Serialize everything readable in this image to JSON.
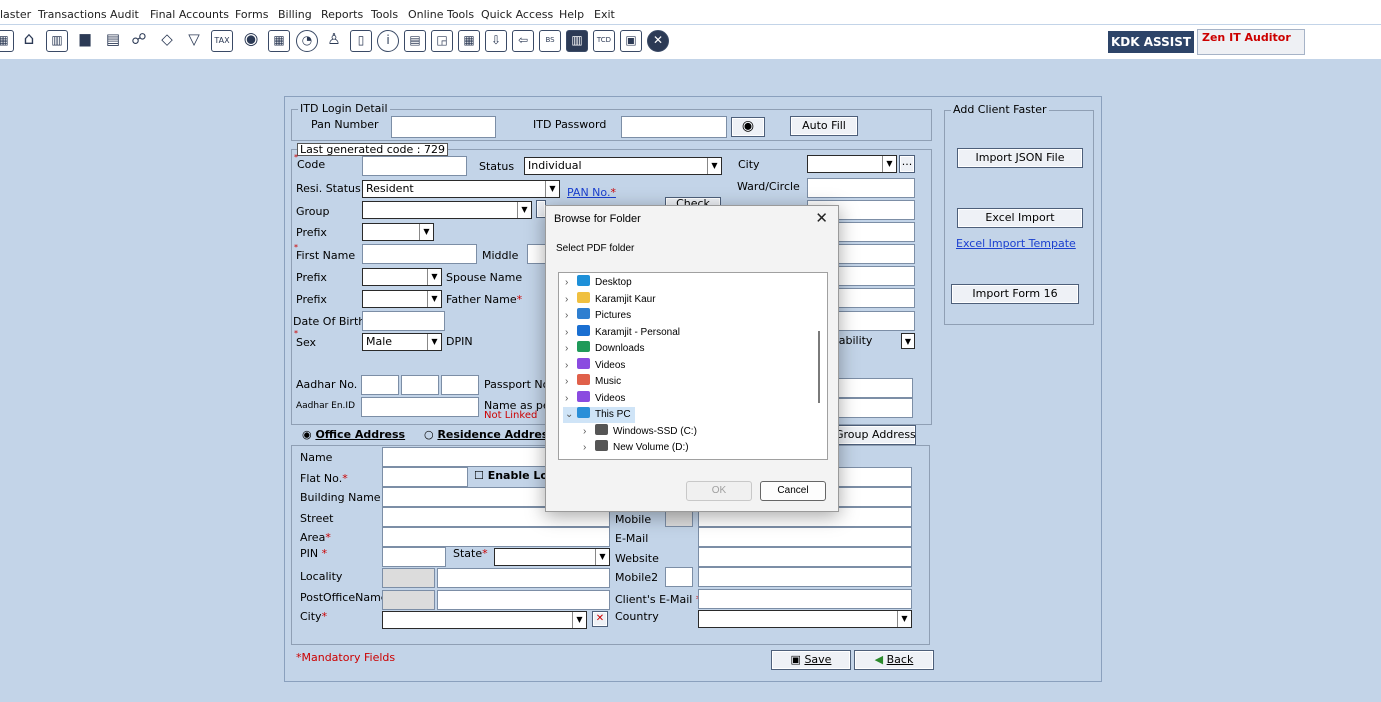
{
  "menu": [
    "laster",
    "Transactions",
    "Audit",
    "Final Accounts",
    "Forms",
    "Billing",
    "Reports",
    "Tools",
    "Online Tools",
    "Quick Access",
    "Help",
    "Exit"
  ],
  "toolbar": {
    "kdk_label": "KDK ASSIST",
    "zen_label": "Zen IT Auditor"
  },
  "itd": {
    "legend": "ITD Login Detail",
    "pan_label": "Pan Number",
    "pan_value": "",
    "password_label": "ITD Password",
    "password_value": "",
    "auto_fill": "Auto Fill"
  },
  "client": {
    "last_code": "Last generated code : 729",
    "code_label": "Code",
    "status_label": "Status",
    "status_value": "Individual",
    "city_label": "City",
    "resi_label": "Resi. Status",
    "resi_value": "Resident",
    "pan_no_label": "PAN No.",
    "ward_label": "Ward/Circle",
    "group_label": "Group",
    "check_label": "Check",
    "prefix_label": "Prefix",
    "first_name_label": "First Name",
    "middle_label": "Middle",
    "spouse_label": "Spouse Name",
    "father_label": "Father Name",
    "dob_label": "Date Of Birth",
    "sex_label": "Sex",
    "sex_value": "Male",
    "dpin_label": "DPIN",
    "disability_value": "sability",
    "aadhar_label": "Aadhar No.",
    "passport_label": "Passport No",
    "aadhar_en_label": "Aadhar En.ID",
    "name_as_label": "Name as pe",
    "not_linked": "Not Linked"
  },
  "address": {
    "office_label": "Office Address",
    "residence_label": "Residence Addres",
    "group_address": "Group Address",
    "name_label": "Name",
    "flat_label": "Flat No.",
    "enable_label": "Enable Lo",
    "building_label": "Building Name",
    "street_label": "Street",
    "mobile_label": "Mobile",
    "area_label": "Area",
    "email_label": "E-Mail",
    "pin_label": "PIN",
    "state_label": "State",
    "website_label": "Website",
    "locality_label": "Locality",
    "mobile2_label": "Mobile2",
    "post_office_label": "PostOfficeName",
    "client_email_label": "Client's E-Mail",
    "city_label": "City",
    "country_label": "Country"
  },
  "footer": {
    "mandatory": "*Mandatory Fields",
    "save": "Save",
    "back": "Back"
  },
  "add_client": {
    "legend": "Add Client Faster",
    "import_json": "Import JSON File",
    "excel_import": "Excel Import",
    "excel_template": "Excel Import Tempate",
    "import_form16": "Import Form 16"
  },
  "dialog": {
    "title": "Browse for Folder",
    "prompt": "Select PDF folder",
    "ok": "OK",
    "cancel": "Cancel",
    "tree": [
      {
        "label": "Desktop",
        "icon": "desktop-icon",
        "color": "#1e90d8",
        "level": 0,
        "expanded": false
      },
      {
        "label": "Karamjit Kaur",
        "icon": "folder-icon",
        "color": "#f0c040",
        "level": 0,
        "expanded": false
      },
      {
        "label": "Pictures",
        "icon": "pictures-icon",
        "color": "#2f7fd0",
        "level": 0,
        "expanded": false
      },
      {
        "label": "Karamjit - Personal",
        "icon": "onedrive-icon",
        "color": "#1a6fd1",
        "level": 0,
        "expanded": false
      },
      {
        "label": "Downloads",
        "icon": "downloads-icon",
        "color": "#1f9a5a",
        "level": 0,
        "expanded": false
      },
      {
        "label": "Videos",
        "icon": "videos-icon",
        "color": "#8a4be0",
        "level": 0,
        "expanded": false
      },
      {
        "label": "Music",
        "icon": "music-icon",
        "color": "#e0604a",
        "level": 0,
        "expanded": false
      },
      {
        "label": "Videos",
        "icon": "videos-icon",
        "color": "#8a4be0",
        "level": 0,
        "expanded": false
      },
      {
        "label": "This PC",
        "icon": "this-pc-icon",
        "color": "#2a8fd8",
        "level": 0,
        "expanded": true,
        "selected": true
      },
      {
        "label": "Windows-SSD (C:)",
        "icon": "drive-c-icon",
        "color": "#555555",
        "level": 1,
        "expanded": false
      },
      {
        "label": "New Volume (D:)",
        "icon": "drive-d-icon",
        "color": "#555555",
        "level": 1,
        "expanded": false
      }
    ]
  }
}
